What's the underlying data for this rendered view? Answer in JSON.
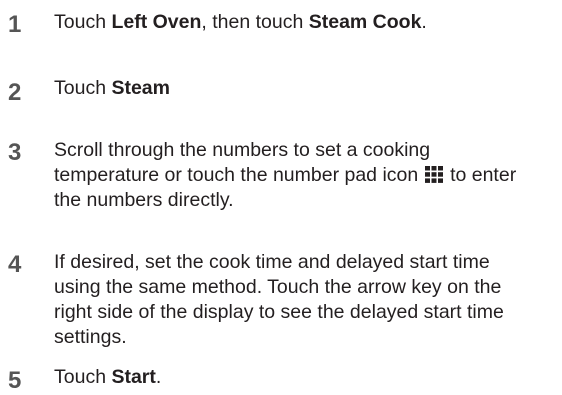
{
  "steps": [
    {
      "number": "1",
      "parts": {
        "a": "Touch ",
        "b": "Left Oven",
        "c": ", then touch ",
        "d": "Steam Cook",
        "e": "."
      }
    },
    {
      "number": "2",
      "parts": {
        "a": "Touch ",
        "b": "Steam"
      }
    },
    {
      "number": "3",
      "parts": {
        "a": "Scroll through the numbers to set a cooking temperature or touch the number pad icon",
        "b": "to enter the numbers directly."
      },
      "icon": "number-pad-icon"
    },
    {
      "number": "4",
      "parts": {
        "a": "If desired, set the cook time and delayed start time using the same method. Touch the arrow key on the right side of the display to see the delayed start time settings."
      }
    },
    {
      "number": "5",
      "parts": {
        "a": "Touch ",
        "b": "Start",
        "c": "."
      }
    }
  ]
}
